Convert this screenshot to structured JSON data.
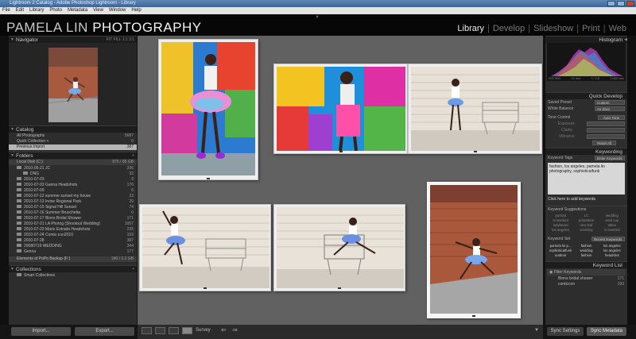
{
  "window": {
    "title": "Lightroom 2 Catalog - Adobe Photoshop Lightroom - Library"
  },
  "menu": [
    "File",
    "Edit",
    "Library",
    "Photo",
    "Metadata",
    "View",
    "Window",
    "Help"
  ],
  "identity_plate": {
    "part1": "PAMELA LIN ",
    "part2": "PHOTOGRAPHY"
  },
  "modules": [
    "Library",
    "Develop",
    "Slideshow",
    "Print",
    "Web"
  ],
  "active_module": "Library",
  "left": {
    "navigator": {
      "title": "Navigator",
      "zoom_options": "FIT  FILL  1:1  3:1"
    },
    "catalog": {
      "title": "Catalog",
      "items": [
        {
          "label": "All Photographs",
          "count": "5687"
        },
        {
          "label": "Quick Collection +",
          "count": "0"
        },
        {
          "label": "Previous Import",
          "count": "387"
        }
      ]
    },
    "folders": {
      "title": "Folders",
      "volume": {
        "label": "Local Disk (C:)",
        "info": "876 / 85 GB"
      },
      "items": [
        {
          "label": "2010-06-21 JC",
          "count": "336"
        },
        {
          "label": "DNG",
          "count": "32"
        },
        {
          "label": "2010-07-03",
          "count": "9"
        },
        {
          "label": "2010-07-03 Ganna Headshots",
          "count": "176"
        },
        {
          "label": "2010-07-09",
          "count": "6"
        },
        {
          "label": "2010-07-12 summer sunset my house",
          "count": "23"
        },
        {
          "label": "2010-07-13 Irvine Regional Park",
          "count": "29"
        },
        {
          "label": "2010-07-15 Signal Hill Sunset",
          "count": "74"
        },
        {
          "label": "2010-07-16 Summer Bruschetta",
          "count": "6"
        },
        {
          "label": "2010-07-17 Binns Bridal Shower",
          "count": "171"
        },
        {
          "label": "2010-07-21 LA Photog (Shootout Wedding)",
          "count": "1057"
        },
        {
          "label": "2010-07-23 Mario Estrada Headshots",
          "count": "235"
        },
        {
          "label": "2010-07-24 Comic-con2010",
          "count": "193"
        },
        {
          "label": "2010-07-28",
          "count": "387"
        },
        {
          "label": "20080719 WEDDING",
          "count": "344"
        },
        {
          "label": "Genna",
          "count": "177"
        }
      ],
      "volume2": {
        "label": "Elements of PoPo Backup (F:)",
        "info": "180 / 3.2 GB"
      }
    },
    "collections": {
      "title": "Collections",
      "items": [
        {
          "label": "Smart Collections"
        }
      ]
    },
    "buttons": {
      "import": "Import...",
      "export": "Export..."
    }
  },
  "toolbar": {
    "sort_label": "Survey"
  },
  "right": {
    "histogram": {
      "title": "Histogram",
      "info": [
        "ISO 200",
        "24 mm",
        "f / 2.8",
        "1/400 sec"
      ]
    },
    "quick_develop": {
      "title": "Quick Develop",
      "rows": [
        {
          "label": "Saved Preset",
          "value": "Custom"
        },
        {
          "label": "White Balance",
          "value": "As Shot"
        },
        {
          "label": "Tone Control",
          "value": "Auto Tone"
        },
        {
          "label": "Exposure",
          "value": ""
        },
        {
          "label": "Clarity",
          "value": ""
        },
        {
          "label": "Vibrance",
          "value": ""
        }
      ],
      "reset": "Reset All"
    },
    "keywording": {
      "title": "Keywording",
      "tags_label": "Keyword Tags",
      "tags_value": "Enter Keywords",
      "keywords_text": "fashion, los angeles, pamela lin photography, sophisticatfunk",
      "add_hint": "Click here to add keywords",
      "suggestions_label": "Keyword Suggestions",
      "suggestions": [
        "portrait",
        "LC",
        "wedding",
        "is lovebird",
        "portraiture",
        "west cup",
        "ladybeard",
        "new leaf",
        "tattoo",
        "los angeles",
        "wedding",
        "is lovebird"
      ],
      "set_label": "Keyword Set",
      "set_value": "Recent Keywords",
      "recent": [
        "pamela lin p...",
        "fashion",
        "los angeles",
        "sophisticatfunk",
        "wedding",
        "los angeles",
        "outdoor",
        "fashion",
        "headshot"
      ]
    },
    "keyword_list": {
      "title": "Keyword List",
      "filter": "Filter Keywords",
      "items": [
        {
          "label": "Binns bridal shower",
          "count": "171"
        },
        {
          "label": "comiccon",
          "count": "193"
        }
      ]
    },
    "buttons": {
      "sync_settings": "Sync Settings",
      "sync_metadata": "Sync Metadata"
    }
  },
  "colors": {
    "accent_active": "#eaeaea",
    "panel_bg": "#2d2d2d",
    "grid_bg": "#616161",
    "cell_bg": "#eeeeee"
  }
}
